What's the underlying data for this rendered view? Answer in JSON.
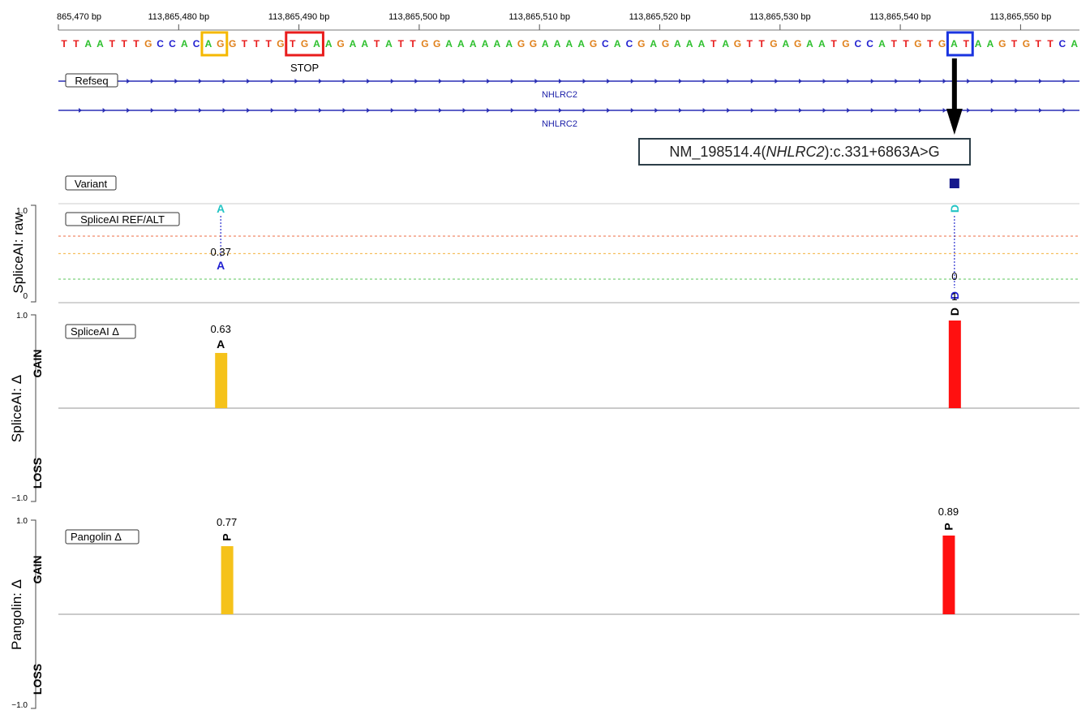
{
  "ruler": {
    "ticks": [
      {
        "label": "865,470 bp",
        "pos": 0
      },
      {
        "label": "113,865,480 bp",
        "pos": 10
      },
      {
        "label": "113,865,490 bp",
        "pos": 20
      },
      {
        "label": "113,865,500 bp",
        "pos": 30
      },
      {
        "label": "113,865,510 bp",
        "pos": 40
      },
      {
        "label": "113,865,520 bp",
        "pos": 50
      },
      {
        "label": "113,865,530 bp",
        "pos": 60
      },
      {
        "label": "113,865,540 bp",
        "pos": 70
      },
      {
        "label": "113,865,550 bp",
        "pos": 80
      }
    ]
  },
  "sequence": "TTAATTTGCCACAGGTTTGTGAAGAATATTGGAAAAAAGGAAAAGCACGAGAAATAGTTGAGAATGCCATTGTGATAAGTGTTCA",
  "base_colors": {
    "A": "#2ec02e",
    "C": "#1f1fd0",
    "G": "#e0801a",
    "T": "#e81c1c"
  },
  "highlights": [
    {
      "name": "acceptor-box",
      "start": 12,
      "end": 13,
      "color": "#f5b800"
    },
    {
      "name": "stop-codon-box",
      "start": 19,
      "end": 21,
      "color": "#e81c1c",
      "label": "STOP"
    },
    {
      "name": "variant-box",
      "start": 74,
      "end": 75,
      "color": "#1a34e0"
    }
  ],
  "refseq": {
    "title": "Refseq",
    "genes": [
      "NHLRC2",
      "NHLRC2"
    ],
    "color": "#2a2fb5"
  },
  "variant": {
    "title": "Variant",
    "hgvs_prefix": "NM_198514.4(",
    "hgvs_gene": "NHLRC2",
    "hgvs_suffix": "):c.331+6863A>G",
    "position": 74.5,
    "color": "#16198c"
  },
  "chart_data": [
    {
      "type": "scatter",
      "title": "SpliceAI REF/ALT",
      "ylabel": "SpliceAI: raw",
      "ylim": [
        0,
        1.0
      ],
      "ytick_labels": [
        "1.0",
        "0"
      ],
      "thresholds": [
        {
          "value": 0.8,
          "color": "#f08a6a"
        },
        {
          "value": 0.5,
          "color": "#f5c060"
        },
        {
          "value": 0.2,
          "color": "#7ed07e"
        }
      ],
      "sites": [
        {
          "x": 13.5,
          "type": "A",
          "ref": 0.37,
          "alt": 1.0,
          "label": "0.37",
          "ref_color": "#1f1fd0",
          "alt_color": "#22c4c4"
        },
        {
          "x": 74.5,
          "type": "D",
          "ref": 0,
          "alt": 1.0,
          "label": "0",
          "ref_color": "#1f1fd0",
          "alt_color": "#22c4c4"
        }
      ]
    },
    {
      "type": "bar",
      "title": "SpliceAI Δ",
      "ylabel": "SpliceAI: Δ",
      "gain_label": "GAIN",
      "loss_label": "LOSS",
      "ylim": [
        -1.0,
        1.0
      ],
      "ytick_labels": [
        "1.0",
        "−1.0"
      ],
      "bars": [
        {
          "x": 13.5,
          "value": 0.63,
          "label": "0.63",
          "site": "A",
          "color": "#f5c21a"
        },
        {
          "x": 74.5,
          "value": 1,
          "label": "1",
          "site": "D",
          "color": "#ff1010"
        }
      ]
    },
    {
      "type": "bar",
      "title": "Pangolin Δ",
      "ylabel": "Pangolin: Δ",
      "gain_label": "GAIN",
      "loss_label": "LOSS",
      "ylim": [
        -1.0,
        1.0
      ],
      "ytick_labels": [
        "1.0",
        "−1.0"
      ],
      "bars": [
        {
          "x": 14,
          "value": 0.77,
          "label": "0.77",
          "site": "P",
          "color": "#f5c21a"
        },
        {
          "x": 74,
          "value": 0.89,
          "label": "0.89",
          "site": "P",
          "color": "#ff1010"
        }
      ]
    }
  ]
}
